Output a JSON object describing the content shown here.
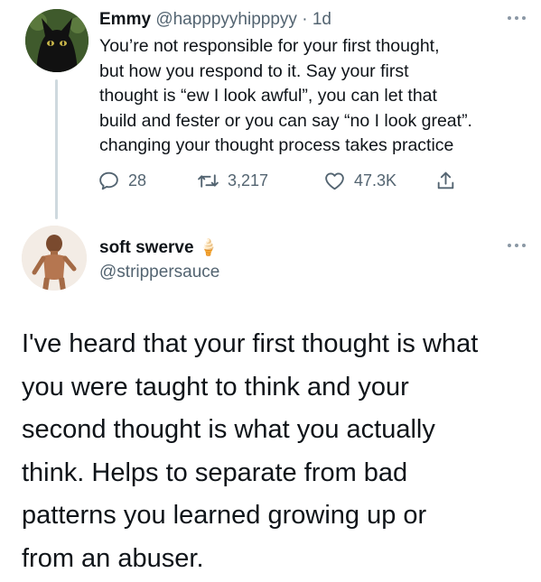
{
  "tweet1": {
    "author": {
      "name": "Emmy",
      "handle": "@happpyyhipppyy",
      "separator": "·",
      "time": "1d"
    },
    "text_lines": [
      "You’re not responsible for your first thought,",
      "but how you respond to it. Say your first",
      "thought is “ew I look awful”, you can let that",
      "build and fester or you can say “no I look great”.",
      "changing your thought process  takes practice"
    ],
    "actions": {
      "replies": "28",
      "retweets": "3,217",
      "likes": "47.3K"
    },
    "icons": [
      "reply-icon",
      "retweet-icon",
      "heart-icon",
      "share-icon",
      "more-icon"
    ]
  },
  "tweet2": {
    "author": {
      "name": "soft swerve",
      "emoji": "🍦",
      "handle": "@strippersauce"
    },
    "text_lines": [
      "I've heard that your first thought is what",
      "you were taught to think and your",
      "second thought is what you actually",
      "think. Helps to separate from bad",
      "patterns you learned growing up or",
      "from an abuser."
    ]
  },
  "colors": {
    "text": "#0f1419",
    "secondary": "#536471",
    "thread_line": "#cfd9de",
    "background": "#ffffff"
  }
}
